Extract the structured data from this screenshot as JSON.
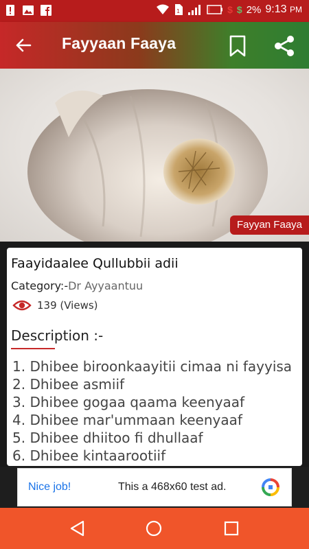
{
  "status_bar": {
    "battery": "2%",
    "time": "9:13",
    "ampm": "PM",
    "dollar_1": "$",
    "dollar_2": "$",
    "icons": [
      "warning-icon",
      "image-icon",
      "facebook-icon",
      "wifi-icon",
      "sim-icon",
      "signal-icon",
      "battery-icon"
    ]
  },
  "app_bar": {
    "title": "Fayyaan Faaya",
    "icons": [
      "back-arrow-icon",
      "bookmark-icon",
      "share-icon"
    ]
  },
  "hero": {
    "tag": "Fayyan Faaya"
  },
  "article": {
    "title": "Faayidaalee Qullubbii adii",
    "category_label": "Category:-",
    "category_value": "Dr Ayyaantuu",
    "views": "139 (Views)",
    "description_heading": "Description :-",
    "description_items": [
      "1. Dhibee biroonkaayitii cimaa ni fayyisa",
      "2. Dhibee asmiif",
      "3. Dhibee gogaa qaama keenyaaf",
      "4. Dhibee mar'ummaan keenyaaf",
      "5. Dhibee dhiitoo fi dhullaaf",
      "6. Dhibee kintaarootiif"
    ]
  },
  "ad": {
    "left_text": "Nice job!",
    "center_text": "This a 468x60 test ad."
  },
  "nav": {
    "icons": [
      "nav-back-icon",
      "nav-home-icon",
      "nav-recent-icon"
    ]
  },
  "colors": {
    "primary_red": "#b71c1c",
    "accent_green": "#2e7d32",
    "nav_orange": "#f0552a",
    "link_blue": "#1a73e8"
  }
}
